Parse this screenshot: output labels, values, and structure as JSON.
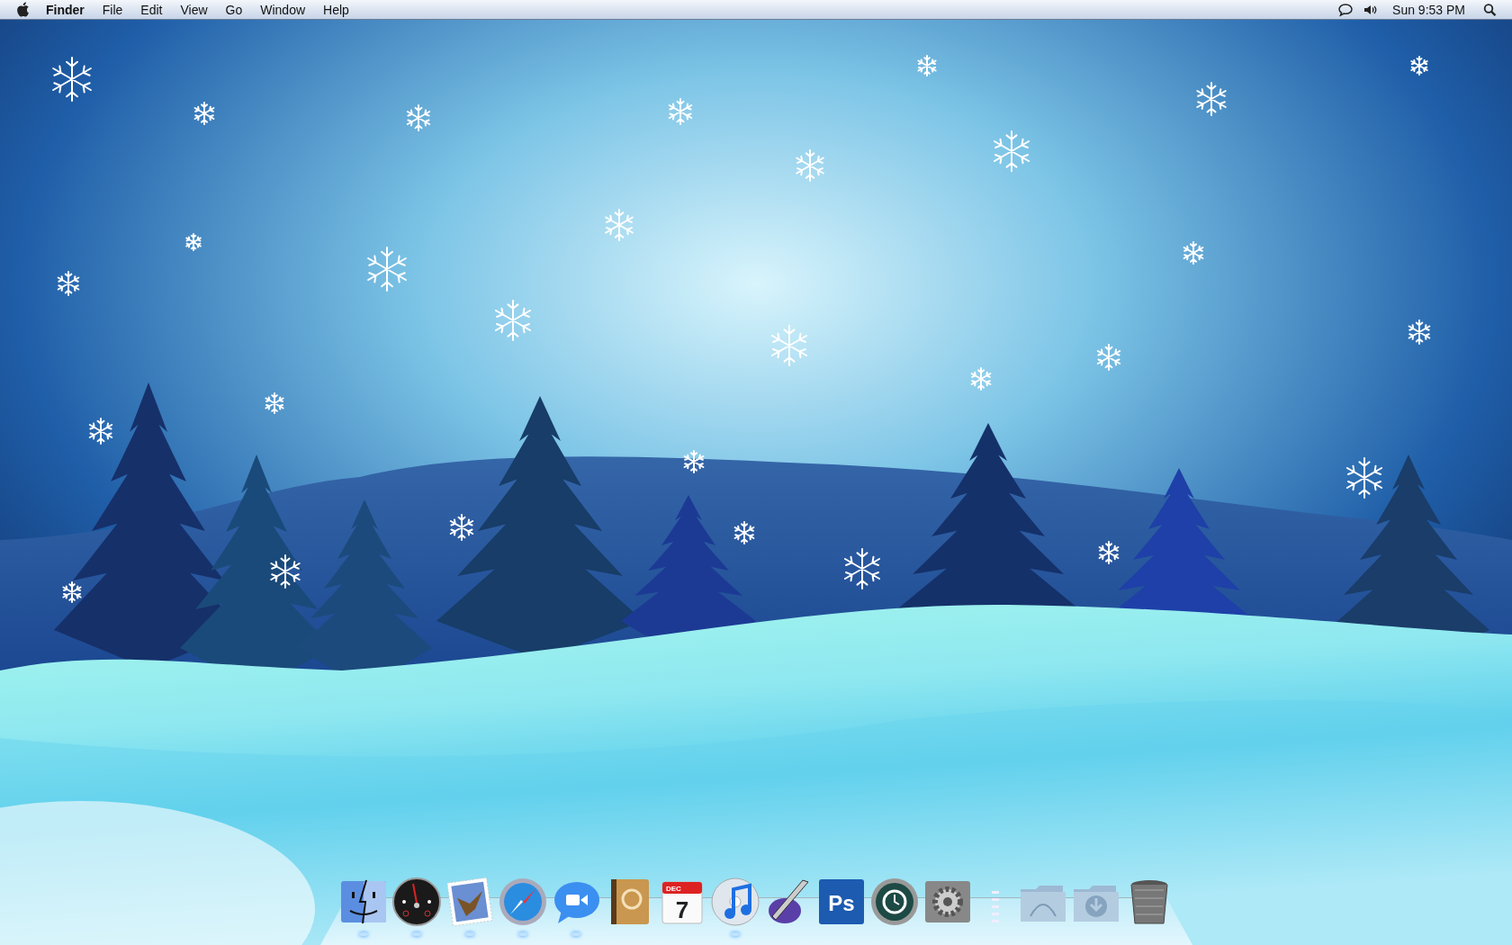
{
  "menu_bar": {
    "app_name": "Finder",
    "menus": [
      "File",
      "Edit",
      "View",
      "Go",
      "Window",
      "Help"
    ],
    "clock": "Sun 9:53 PM"
  },
  "dock": {
    "items": [
      {
        "kind": "finder",
        "running": true
      },
      {
        "kind": "dashboard",
        "running": true
      },
      {
        "kind": "mail",
        "running": true
      },
      {
        "kind": "safari",
        "running": true
      },
      {
        "kind": "ichat",
        "running": true
      },
      {
        "kind": "address_book",
        "running": false
      },
      {
        "kind": "calendar",
        "running": false,
        "month": "DEC",
        "day": "7"
      },
      {
        "kind": "itunes",
        "running": true
      },
      {
        "kind": "quill",
        "running": false
      },
      {
        "kind": "photoshop",
        "running": false,
        "label": "Ps"
      },
      {
        "kind": "time_machine",
        "running": false
      },
      {
        "kind": "preferences",
        "running": false
      },
      {
        "kind": "separator"
      },
      {
        "kind": "folder_curve",
        "running": false
      },
      {
        "kind": "folder_download",
        "running": false
      },
      {
        "kind": "trash",
        "running": false
      }
    ]
  }
}
